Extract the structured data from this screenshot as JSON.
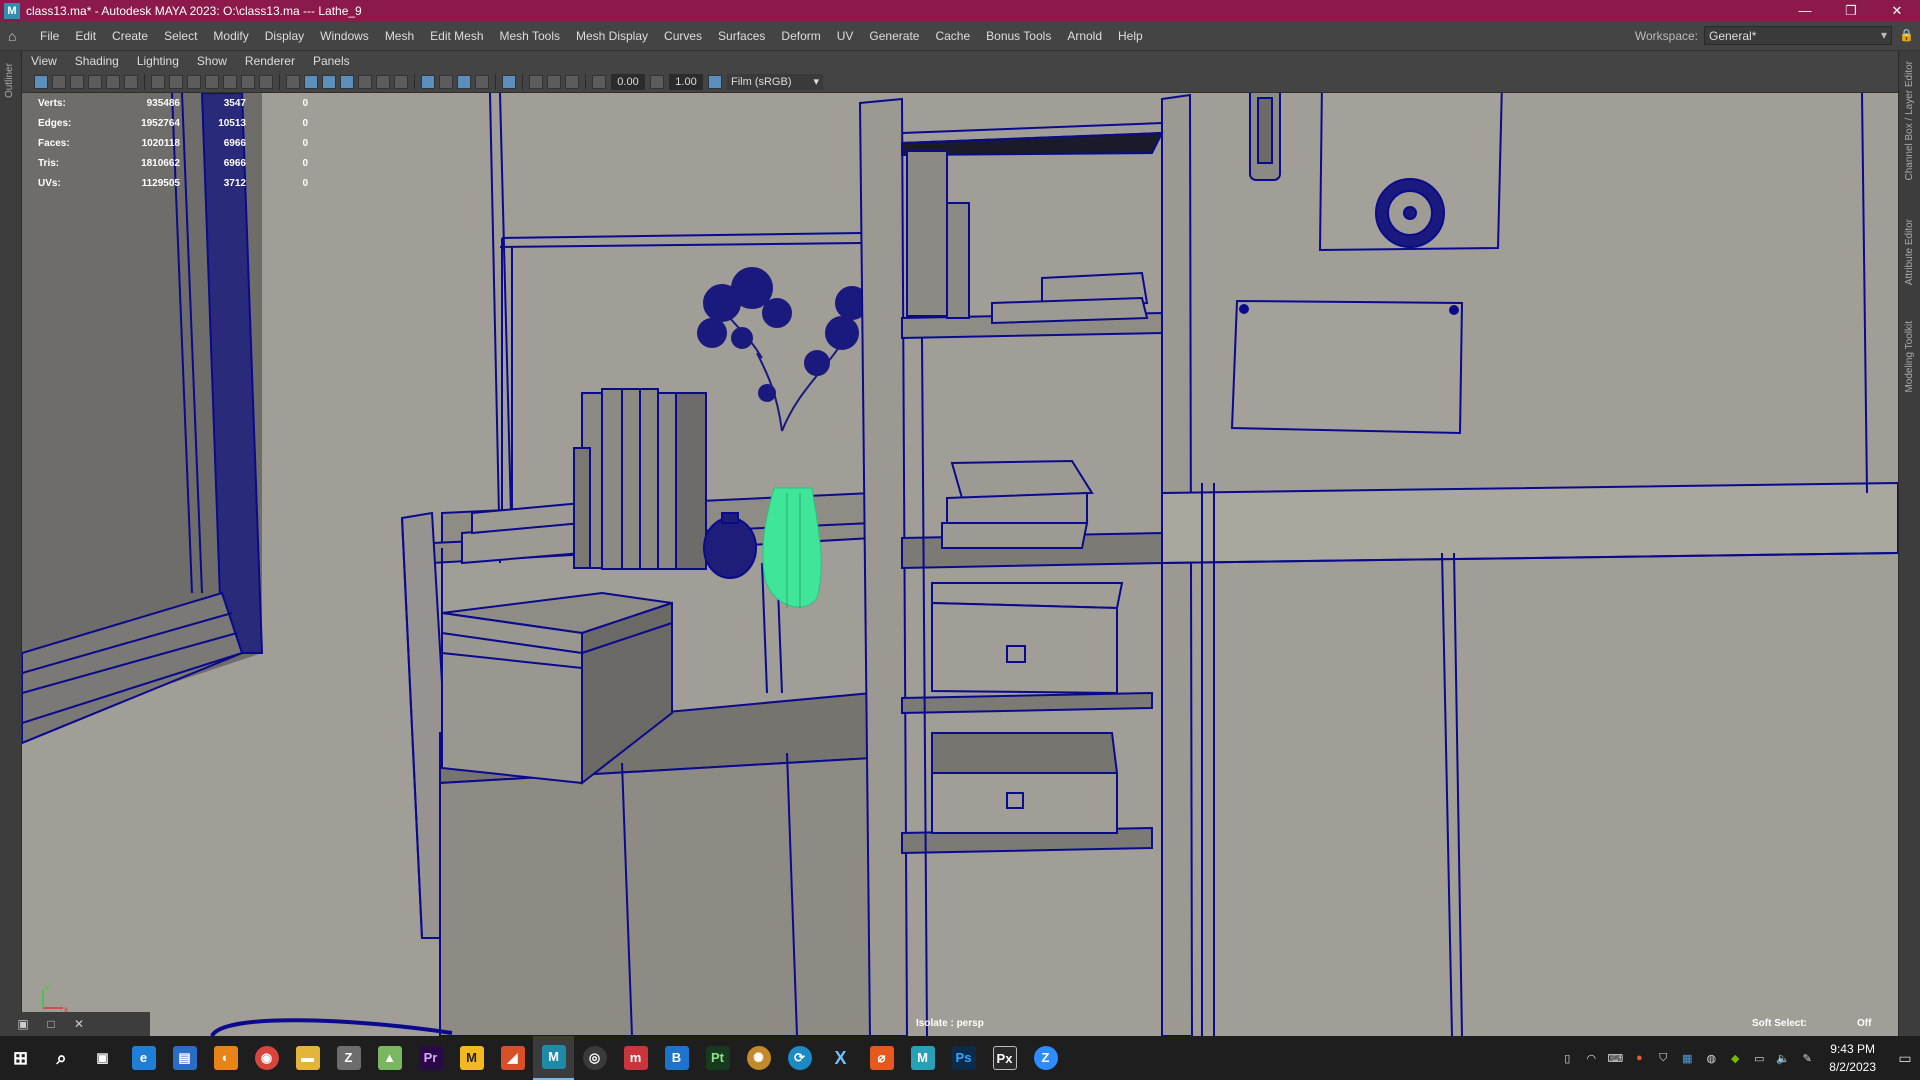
{
  "titlebar": {
    "logo": "M",
    "title": "class13.ma* - Autodesk MAYA 2023: O:\\class13.ma  ---  Lathe_9",
    "minimize": "—",
    "restore": "❐",
    "close": "✕"
  },
  "menubar": {
    "items": [
      "File",
      "Edit",
      "Create",
      "Select",
      "Modify",
      "Display",
      "Windows",
      "Mesh",
      "Edit Mesh",
      "Mesh Tools",
      "Mesh Display",
      "Curves",
      "Surfaces",
      "Deform",
      "UV",
      "Generate",
      "Cache",
      "Bonus Tools",
      "Arnold",
      "Help"
    ],
    "workspace_label": "Workspace:",
    "workspace_value": "General*"
  },
  "side_tabs": {
    "left": "Outliner",
    "right": [
      "Channel Box / Layer Editor",
      "Attribute Editor",
      "Modeling Toolkit"
    ]
  },
  "panel_menu": [
    "View",
    "Shading",
    "Lighting",
    "Show",
    "Renderer",
    "Panels"
  ],
  "viewport_toolbar": {
    "exposure": "0.00",
    "gamma": "1.00",
    "color_space": "Film (sRGB)"
  },
  "hud": {
    "rows": [
      {
        "label": "Verts:",
        "total": "935486",
        "selected": "3547",
        "extra": "0"
      },
      {
        "label": "Edges:",
        "total": "1952764",
        "selected": "10513",
        "extra": "0"
      },
      {
        "label": "Faces:",
        "total": "1020118",
        "selected": "6966",
        "extra": "0"
      },
      {
        "label": "Tris:",
        "total": "1810662",
        "selected": "6966",
        "extra": "0"
      },
      {
        "label": "UVs:",
        "total": "1129505",
        "selected": "3712",
        "extra": "0"
      }
    ],
    "isolate": "Isolate : persp",
    "soft_select_label": "Soft Select:",
    "soft_select_value": "Off",
    "axis_x": "x",
    "axis_y": "y"
  },
  "colors": {
    "wire": "#0a0a8c",
    "selected": "#3fe69a",
    "background": "#9f9c96",
    "titlebar": "#8b1a4a"
  },
  "taskbar": {
    "apps": [
      {
        "name": "windows-start-icon",
        "glyph": "⊞",
        "color": "#1e1e1e"
      },
      {
        "name": "search-icon",
        "glyph": "⌕",
        "color": "#1e1e1e"
      },
      {
        "name": "task-view-icon",
        "glyph": "▣",
        "color": "#1e1e1e"
      },
      {
        "name": "edge-icon",
        "glyph": "e",
        "color": "#1f7fd6"
      },
      {
        "name": "store-icon",
        "glyph": "▤",
        "color": "#2b6cc4"
      },
      {
        "name": "blender-icon",
        "glyph": "◐",
        "color": "#e8831a"
      },
      {
        "name": "chrome-icon",
        "glyph": "◉",
        "color": "#d9453c"
      },
      {
        "name": "file-explorer-icon",
        "glyph": "▬",
        "color": "#e3b53b"
      },
      {
        "name": "zbrush-icon",
        "glyph": "Z",
        "color": "#6d6d6d"
      },
      {
        "name": "image-viewer-icon",
        "glyph": "▲",
        "color": "#7bb661"
      },
      {
        "name": "premiere-icon",
        "glyph": "Pr",
        "color": "#2a0a45"
      },
      {
        "name": "marmoset-icon",
        "glyph": "M",
        "color": "#f1b81f"
      },
      {
        "name": "substance-icon",
        "glyph": "◢",
        "color": "#d8502a"
      },
      {
        "name": "maya-icon",
        "glyph": "M",
        "color": "#1f8aa8"
      },
      {
        "name": "obs-icon",
        "glyph": "◎",
        "color": "#3a3a3a"
      },
      {
        "name": "mudbox-icon",
        "glyph": "m",
        "color": "#c8353c"
      },
      {
        "name": "blue-app-icon",
        "glyph": "B",
        "color": "#1d74c8"
      },
      {
        "name": "substance-painter-icon",
        "glyph": "Pt",
        "color": "#173a1e"
      },
      {
        "name": "globe-app-icon",
        "glyph": "✺",
        "color": "#c48a2a"
      },
      {
        "name": "steam-icon",
        "glyph": "⟳",
        "color": "#1c8bc5"
      },
      {
        "name": "xnormal-icon",
        "glyph": "X",
        "color": "#1e1e1e"
      },
      {
        "name": "houdini-icon",
        "glyph": "⌀",
        "color": "#e55a1c"
      },
      {
        "name": "maya2-icon",
        "glyph": "M",
        "color": "#27a0b8"
      },
      {
        "name": "photoshop-icon",
        "glyph": "Ps",
        "color": "#0b2b4a"
      },
      {
        "name": "pixelmator-icon",
        "glyph": "Px",
        "color": "#2a2a2a"
      },
      {
        "name": "zoom-icon",
        "glyph": "Z",
        "color": "#2d8cff"
      }
    ],
    "time": "9:43 PM",
    "date": "8/2/2023"
  }
}
